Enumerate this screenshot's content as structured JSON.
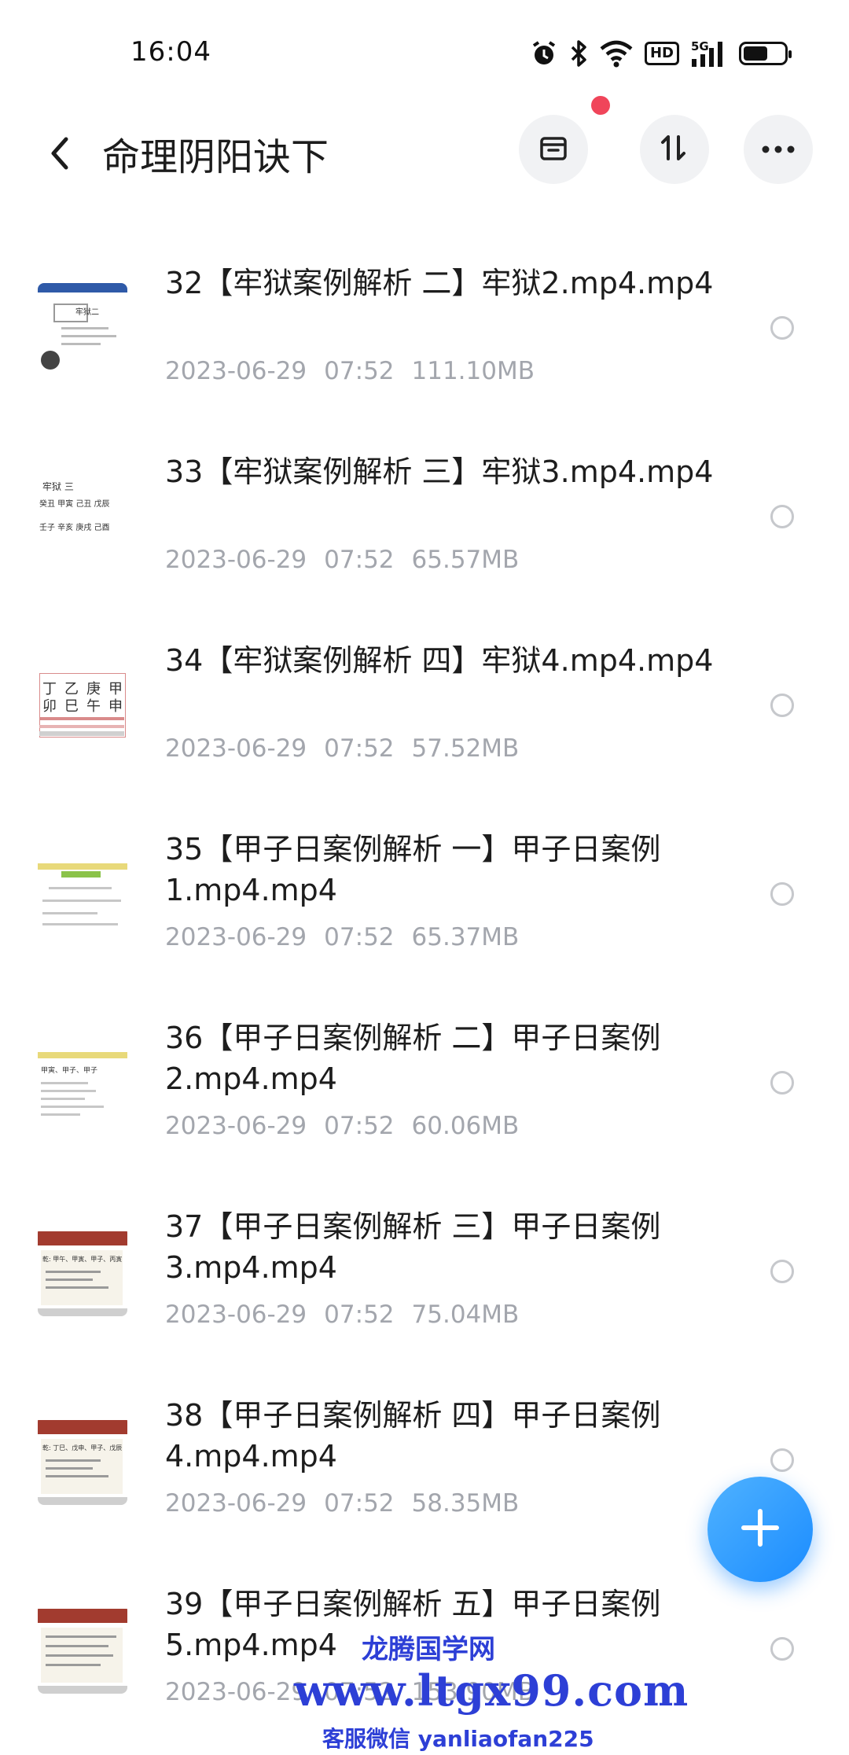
{
  "status_bar": {
    "time": "16:04",
    "icons": [
      "alarm-icon",
      "bluetooth-icon",
      "wifi-icon",
      "hd-icon",
      "signal-5g-icon",
      "battery-icon"
    ],
    "hd_label": "HD",
    "network_label": "5G",
    "battery_level": 0.6
  },
  "header": {
    "title": "命理阴阳诀下",
    "back_icon": "chevron-left-icon",
    "actions": [
      "archive-icon",
      "sort-icon",
      "more-icon"
    ],
    "accent_dot_color": "#f0455a"
  },
  "files": [
    {
      "name": "32【牢狱案例解析 二】牢狱2.mp4.mp4",
      "date": "2023-06-29",
      "time": "07:52",
      "size": "111.10MB",
      "thumb_text": [
        "牢狱二"
      ]
    },
    {
      "name": "33【牢狱案例解析 三】牢狱3.mp4.mp4",
      "date": "2023-06-29",
      "time": "07:52",
      "size": "65.57MB",
      "thumb_text": [
        "牢狱 三",
        "癸丑 甲寅 己丑 戊辰",
        "壬子 辛亥 庚戌 己酉"
      ]
    },
    {
      "name": "34【牢狱案例解析 四】牢狱4.mp4.mp4",
      "date": "2023-06-29",
      "time": "07:52",
      "size": "57.52MB",
      "thumb_text": [
        "丁",
        "乙",
        "庚",
        "甲",
        "卯",
        "巳",
        "午",
        "申"
      ]
    },
    {
      "name": "35【甲子日案例解析 一】甲子日案例1.mp4.mp4",
      "date": "2023-06-29",
      "time": "07:52",
      "size": "65.37MB",
      "thumb_text": []
    },
    {
      "name": "36【甲子日案例解析 二】甲子日案例2.mp4.mp4",
      "date": "2023-06-29",
      "time": "07:52",
      "size": "60.06MB",
      "thumb_text": [
        "甲寅、甲子、甲子"
      ]
    },
    {
      "name": "37【甲子日案例解析 三】甲子日案例3.mp4.mp4",
      "date": "2023-06-29",
      "time": "07:52",
      "size": "75.04MB",
      "thumb_text": [
        "乾: 甲午、甲寅、甲子、丙寅"
      ]
    },
    {
      "name": "38【甲子日案例解析 四】甲子日案例4.mp4.mp4",
      "date": "2023-06-29",
      "time": "07:52",
      "size": "58.35MB",
      "thumb_text": [
        "乾: 丁巳、戊申、甲子、戊辰"
      ]
    },
    {
      "name": "39【甲子日案例解析 五】甲子日案例5.mp4.mp4",
      "date": "2023-06-29",
      "time": "07:52",
      "size": "153.90MB",
      "thumb_text": []
    }
  ],
  "fab": {
    "icon": "plus-icon",
    "color": "#1b8cff"
  },
  "watermark": {
    "line1": "龙腾国学网",
    "line2": "www.ltgx99.com",
    "line3": "客服微信 yanliaofan225",
    "color": "#2d3fd6"
  }
}
